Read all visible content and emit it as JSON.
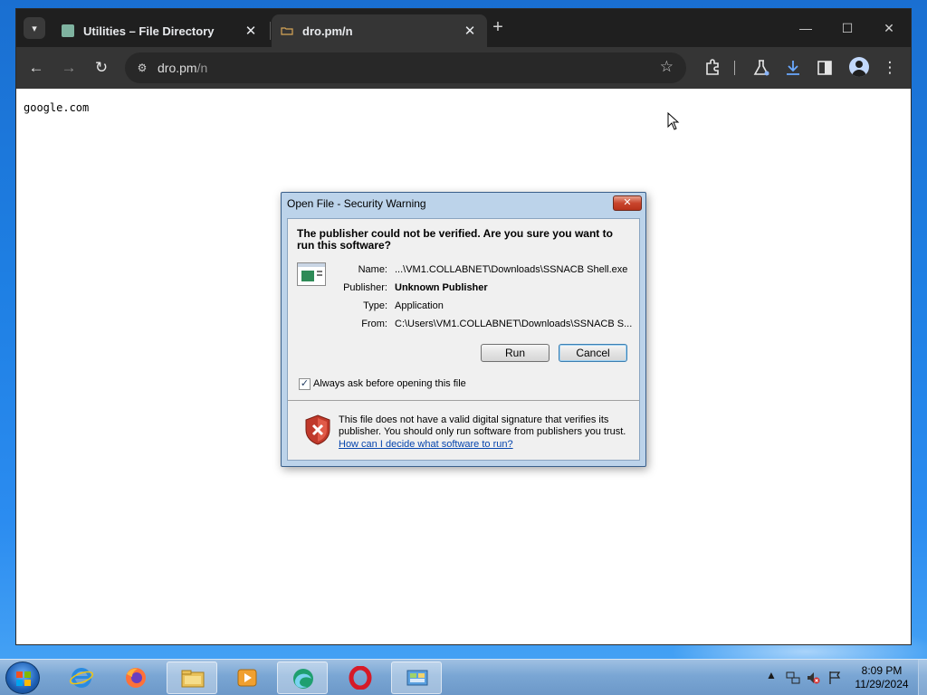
{
  "browser": {
    "tabs": [
      {
        "title": "Utilities – File Directory",
        "active": false
      },
      {
        "title": "dro.pm/n",
        "active": true
      }
    ],
    "new_tab": "+",
    "window_controls": {
      "minimize": "—",
      "maximize": "☐",
      "close": "✕"
    },
    "toolbar": {
      "back": "←",
      "forward": "→",
      "reload": "↻",
      "site_info": "⚙",
      "url_host": "dro.pm",
      "url_path": "/n",
      "bookmark": "☆"
    },
    "page": {
      "text": "google.com"
    }
  },
  "dialog": {
    "title": "Open File - Security Warning",
    "close": "✕",
    "heading": "The publisher could not be verified.  Are you sure you want to run this software?",
    "fields": [
      {
        "key": "Name:",
        "value": "...\\VM1.COLLABNET\\Downloads\\SSNACB Shell.exe",
        "bold": false
      },
      {
        "key": "Publisher:",
        "value": "Unknown Publisher",
        "bold": true
      },
      {
        "key": "Type:",
        "value": "Application",
        "bold": false
      },
      {
        "key": "From:",
        "value": "C:\\Users\\VM1.COLLABNET\\Downloads\\SSNACB S...",
        "bold": false
      }
    ],
    "run_label": "Run",
    "cancel_label": "Cancel",
    "checkbox_label": "Always ask before opening this file",
    "checkbox_checked": true,
    "checkbox_mark": "✓",
    "warning_text": "This file does not have a valid digital signature that verifies its publisher.  You should only run software from publishers you trust.",
    "warning_link": "How can I decide what software to run?"
  },
  "taskbar": {
    "clock_time": "8:09 PM",
    "clock_date": "11/29/2024",
    "tray_arrow": "▲",
    "icons": [
      "start-orb",
      "internet-explorer-icon",
      "firefox-icon",
      "file-explorer-icon",
      "media-player-icon",
      "edge-icon",
      "opera-icon",
      "control-panel-icon"
    ]
  },
  "colors": {
    "chrome_dark": "#1f1f1f",
    "chrome_toolbar": "#353535",
    "dialog_frame": "#bcd3ea",
    "link": "#0645ad",
    "desktop_blue": "#1e7fe3"
  }
}
